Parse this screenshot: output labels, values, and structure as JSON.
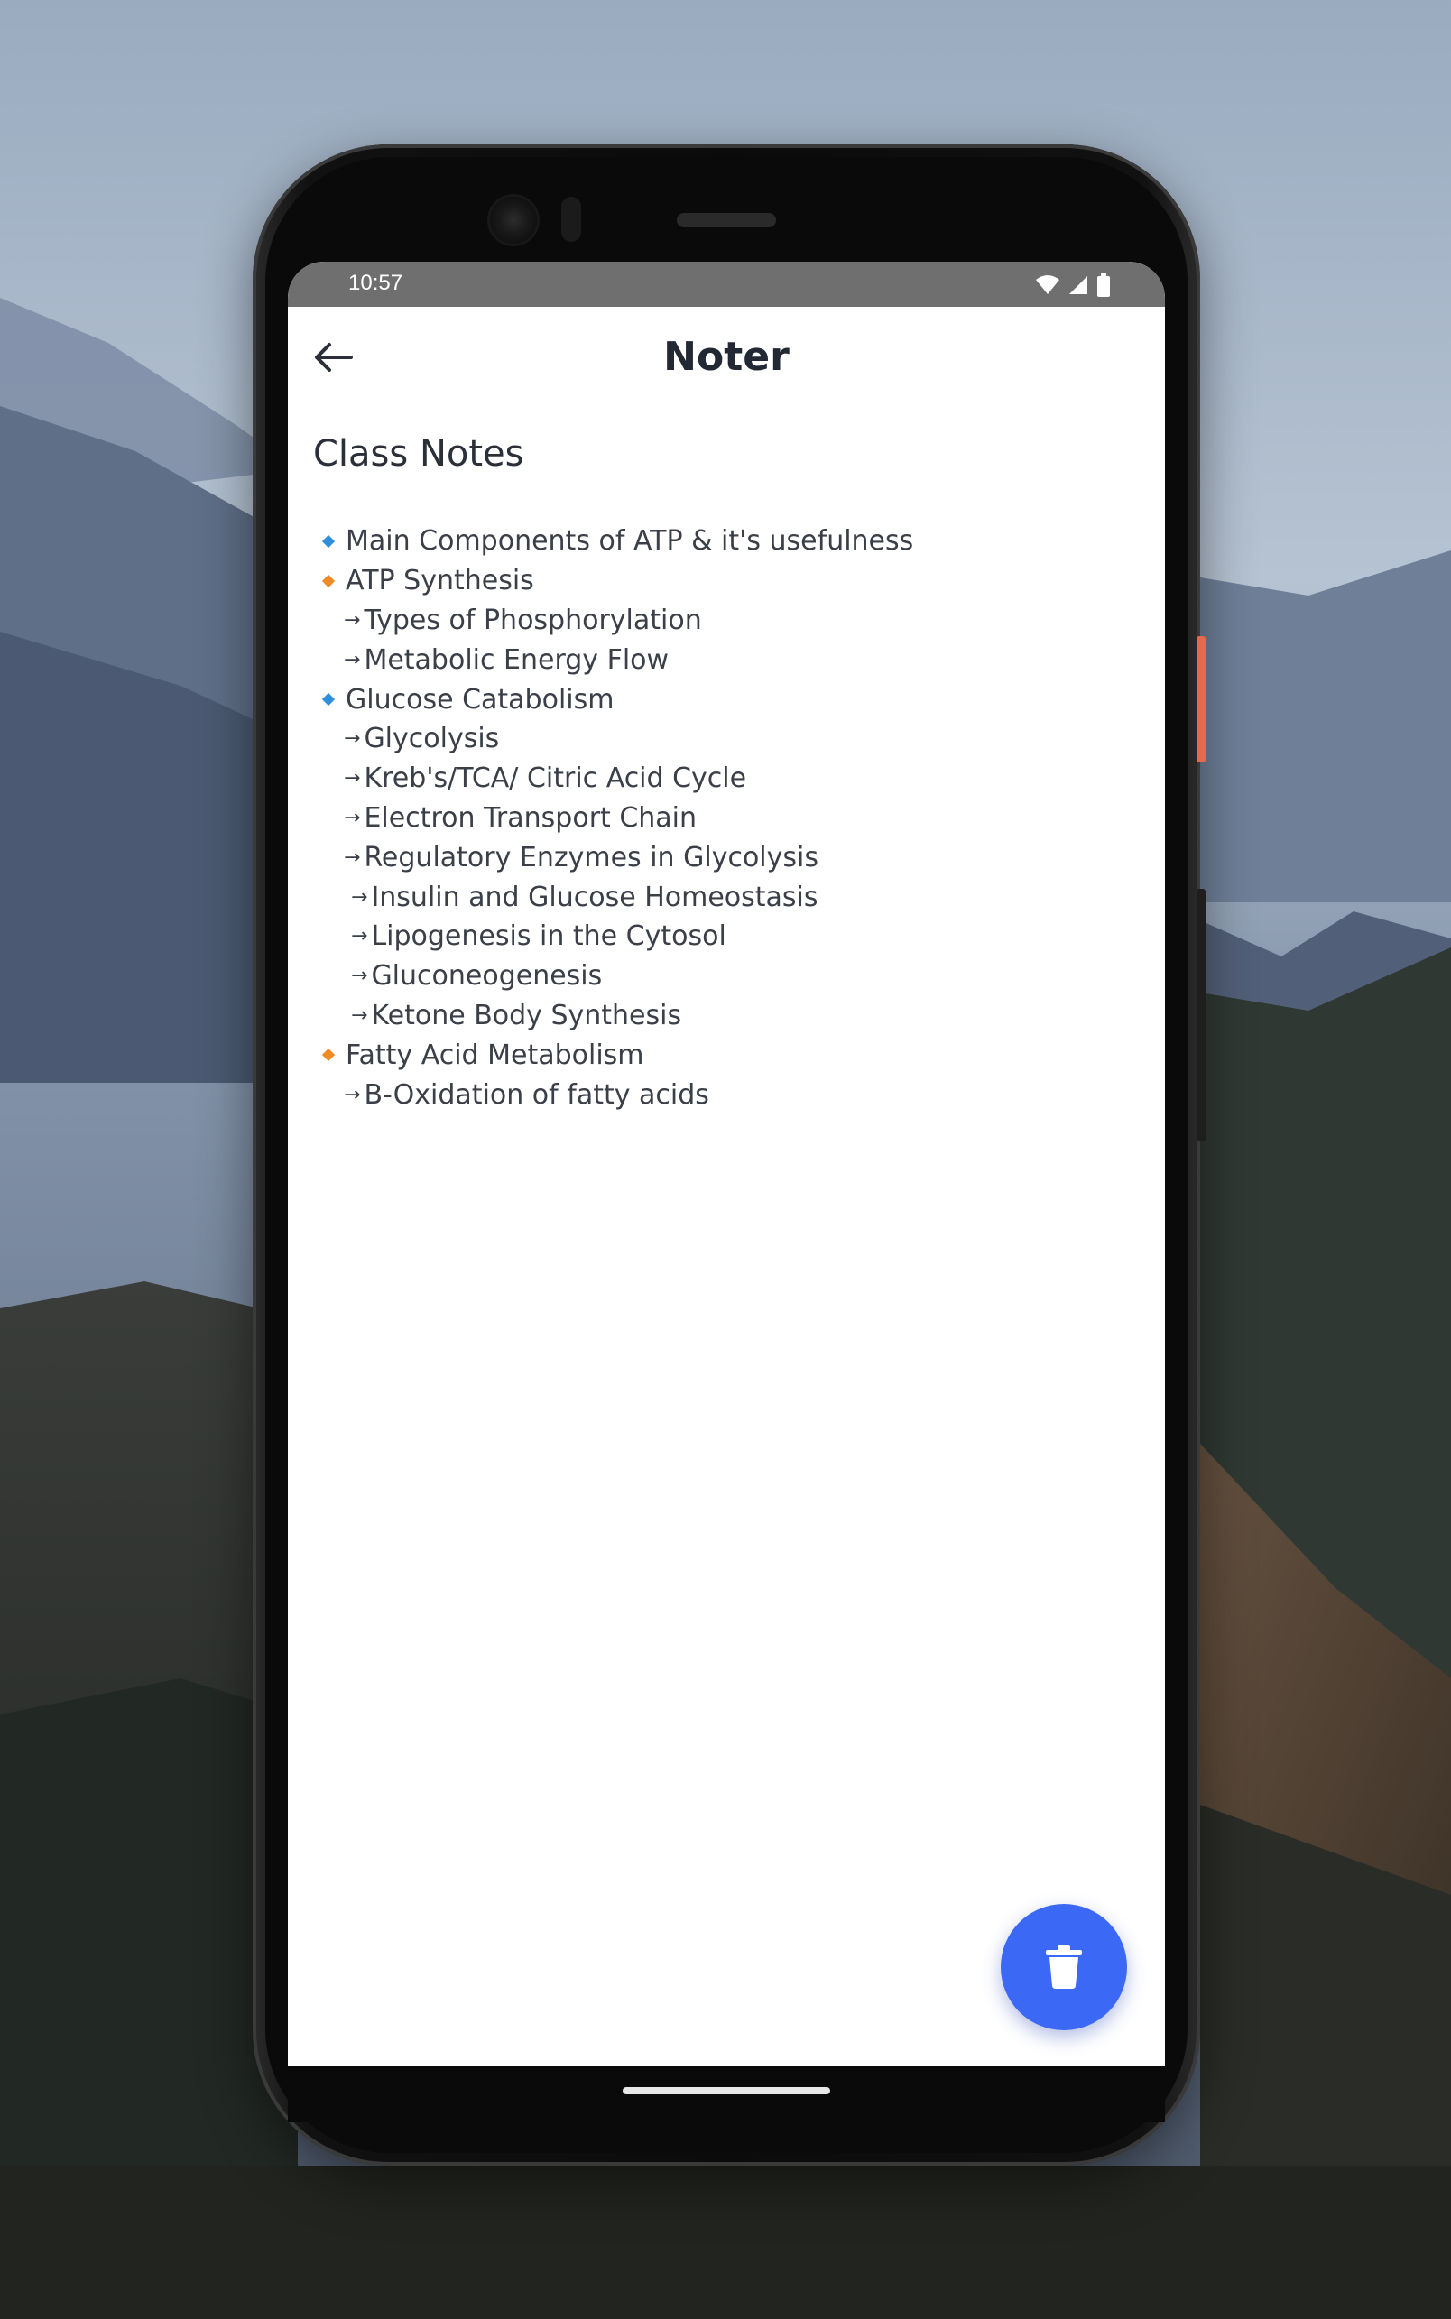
{
  "status_bar": {
    "time": "10:57",
    "icons": [
      "wifi-icon",
      "signal-icon",
      "battery-icon"
    ]
  },
  "app_bar": {
    "back_icon": "arrow-left-icon",
    "title": "Noter"
  },
  "note": {
    "title": "Class Notes",
    "lines": [
      {
        "marker": "blue-diamond",
        "text": "Main Components of ATP & it's usefulness"
      },
      {
        "marker": "orange-diamond",
        "text": "ATP Synthesis"
      },
      {
        "marker": "arrow",
        "text": "Types of Phosphorylation"
      },
      {
        "marker": "arrow",
        "text": "Metabolic Energy Flow"
      },
      {
        "marker": "blue-diamond",
        "text": "Glucose Catabolism"
      },
      {
        "marker": "arrow",
        "text": "Glycolysis"
      },
      {
        "marker": "arrow",
        "text": "Kreb's/TCA/ Citric Acid Cycle"
      },
      {
        "marker": "arrow",
        "text": "Electron Transport Chain"
      },
      {
        "marker": "arrow",
        "text": "Regulatory Enzymes in Glycolysis"
      },
      {
        "marker": "arrow2",
        "text": "Insulin and Glucose Homeostasis"
      },
      {
        "marker": "arrow2",
        "text": "Lipogenesis in the Cytosol"
      },
      {
        "marker": "arrow2",
        "text": "Gluconeogenesis"
      },
      {
        "marker": "arrow2",
        "text": "Ketone Body Synthesis"
      },
      {
        "marker": "orange-diamond",
        "text": "Fatty Acid Metabolism"
      },
      {
        "marker": "arrow",
        "text": "B-Oxidation of fatty acids"
      }
    ]
  },
  "fab": {
    "icon": "trash-icon"
  },
  "colors": {
    "accent": "#3b69f5",
    "bullet_blue": "#2f8fdc",
    "bullet_orange": "#f08a24",
    "status_bar": "#6f6f6f"
  }
}
